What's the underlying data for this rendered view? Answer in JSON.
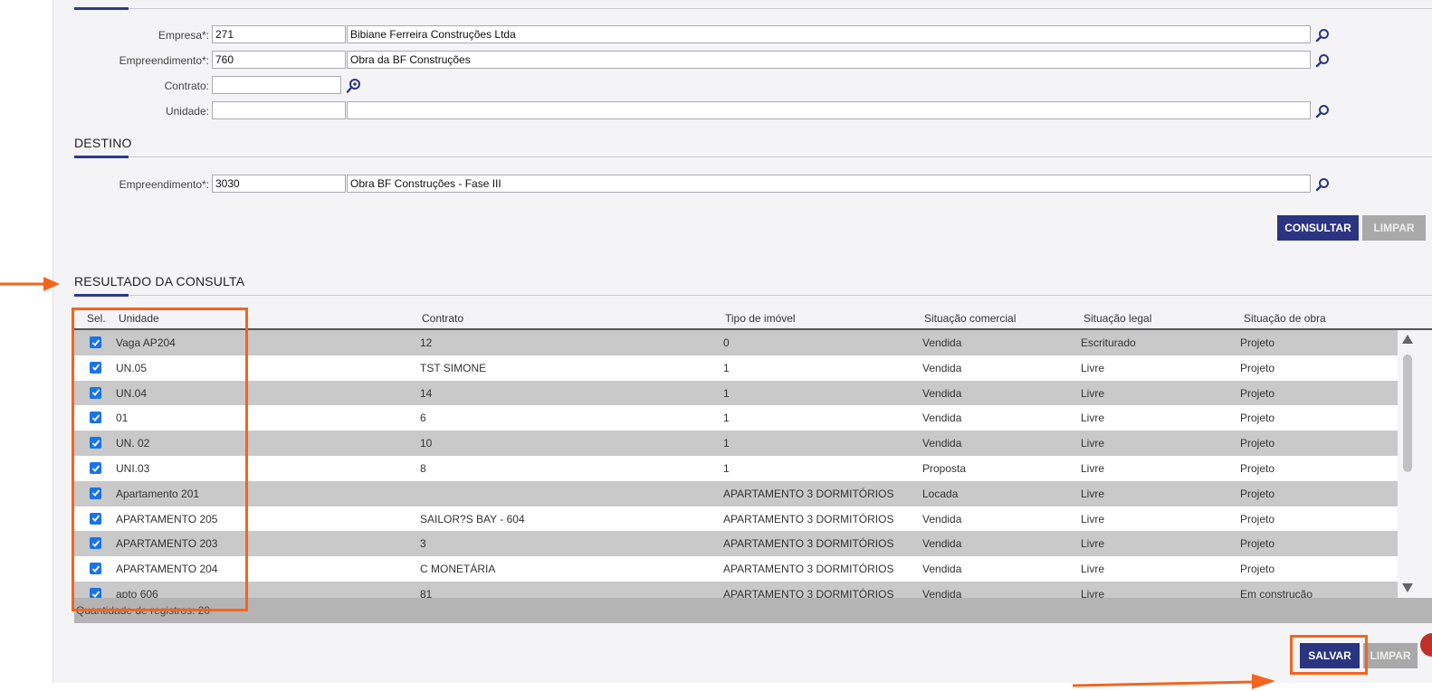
{
  "origem": {
    "empresa": {
      "label": "Empresa*:",
      "code": "271",
      "name": "Bibiane Ferreira Construções Ltda"
    },
    "empreendimento": {
      "label": "Empreendimento*:",
      "code": "760",
      "name": "Obra da BF Construções"
    },
    "contrato": {
      "label": "Contrato:",
      "code": ""
    },
    "unidade": {
      "label": "Unidade:",
      "code": "",
      "name": ""
    }
  },
  "destino": {
    "title": "DESTINO",
    "empreendimento": {
      "label": "Empreendimento*:",
      "code": "3030",
      "name": "Obra BF Construções - Fase III"
    }
  },
  "buttons": {
    "consultar": "CONSULTAR",
    "limpar": "LIMPAR",
    "salvar": "SALVAR",
    "limpar2": "LIMPAR"
  },
  "resultado": {
    "title": "RESULTADO DA CONSULTA",
    "columns": [
      "Sel.",
      "Unidade",
      "Contrato",
      "Tipo de imóvel",
      "Situação comercial",
      "Situação legal",
      "Situação de obra"
    ],
    "rows": [
      {
        "unidade": "Vaga AP204",
        "contrato": "12",
        "tipo": "0",
        "comercial": "Vendida",
        "legal": "Escriturado",
        "obra": "Projeto"
      },
      {
        "unidade": "UN.05",
        "contrato": "TST SIMONE",
        "tipo": "1",
        "comercial": "Vendida",
        "legal": "Livre",
        "obra": "Projeto"
      },
      {
        "unidade": "UN.04",
        "contrato": "14",
        "tipo": "1",
        "comercial": "Vendida",
        "legal": "Livre",
        "obra": "Projeto"
      },
      {
        "unidade": "01",
        "contrato": "6",
        "tipo": "1",
        "comercial": "Vendida",
        "legal": "Livre",
        "obra": "Projeto"
      },
      {
        "unidade": "UN. 02",
        "contrato": "10",
        "tipo": "1",
        "comercial": "Vendida",
        "legal": "Livre",
        "obra": "Projeto"
      },
      {
        "unidade": "UNI.03",
        "contrato": "8",
        "tipo": "1",
        "comercial": "Proposta",
        "legal": "Livre",
        "obra": "Projeto"
      },
      {
        "unidade": "Apartamento 201",
        "contrato": "",
        "tipo": "APARTAMENTO 3 DORMITÓRIOS",
        "comercial": "Locada",
        "legal": "Livre",
        "obra": "Projeto"
      },
      {
        "unidade": "APARTAMENTO 205",
        "contrato": "SAILOR?S BAY - 604",
        "tipo": "APARTAMENTO 3 DORMITÓRIOS",
        "comercial": "Vendida",
        "legal": "Livre",
        "obra": "Projeto"
      },
      {
        "unidade": "APARTAMENTO 203",
        "contrato": "3",
        "tipo": "APARTAMENTO 3 DORMITÓRIOS",
        "comercial": "Vendida",
        "legal": "Livre",
        "obra": "Projeto"
      },
      {
        "unidade": "APARTAMENTO 204",
        "contrato": "C MONETÁRIA",
        "tipo": "APARTAMENTO 3 DORMITÓRIOS",
        "comercial": "Vendida",
        "legal": "Livre",
        "obra": "Projeto"
      },
      {
        "unidade": "apto 606",
        "contrato": "81",
        "tipo": "APARTAMENTO 3 DORMITÓRIOS",
        "comercial": "Vendida",
        "legal": "Livre",
        "obra": "Em construção"
      }
    ],
    "footer": "Quantidade de registros: 20"
  },
  "colors": {
    "primary": "#2b3480",
    "accent": "#f4641e",
    "checkbox": "#1a73e8"
  },
  "icons": [
    "search-icon",
    "search-advanced-icon",
    "checkbox-checked-icon",
    "scroll-up-icon",
    "scroll-down-icon",
    "arrow-annotation"
  ]
}
